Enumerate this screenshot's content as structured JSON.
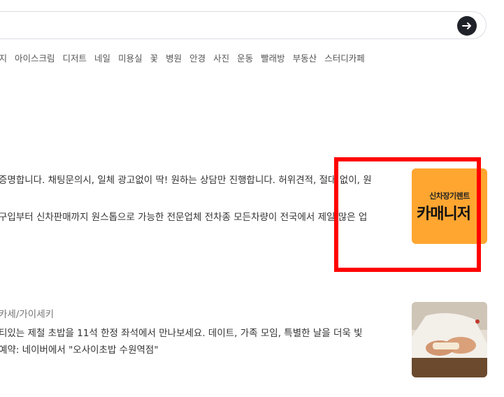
{
  "search": {
    "submit_icon": "arrow-right-icon"
  },
  "keywords": [
    "가지",
    "아이스크림",
    "디저트",
    "네일",
    "미용실",
    "꽃",
    "병원",
    "안경",
    "사진",
    "운동",
    "빨래방",
    "부동산",
    "스터디카페"
  ],
  "results": [
    {
      "line1": "증명합니다. 채팅문의시, 일체 광고없이 딱! 원하는 상담만 진행합니다. 허위견적, 절대 없이, 원",
      "line2": "구입부터 신차판매까지 원스톱으로 가능한 전문업체 전차종 모든차량이 전국에서 제일 많은 업",
      "thumb_small": "신차장기렌트",
      "thumb_big": "카매니저"
    },
    {
      "source": "카세/가이세키",
      "line1": "티있는 제철 초밥을 11석 한정 좌석에서 만나보세요. 데이트, 가족 모임, 특별한 날을 더욱 빛",
      "line2": "예약: 네이버에서 \"오사이초밥 수원역점\""
    }
  ],
  "colors": {
    "thumb_bg": "#ffa631",
    "highlight_box": "#ff0000",
    "submit_button": "#1f2229"
  }
}
